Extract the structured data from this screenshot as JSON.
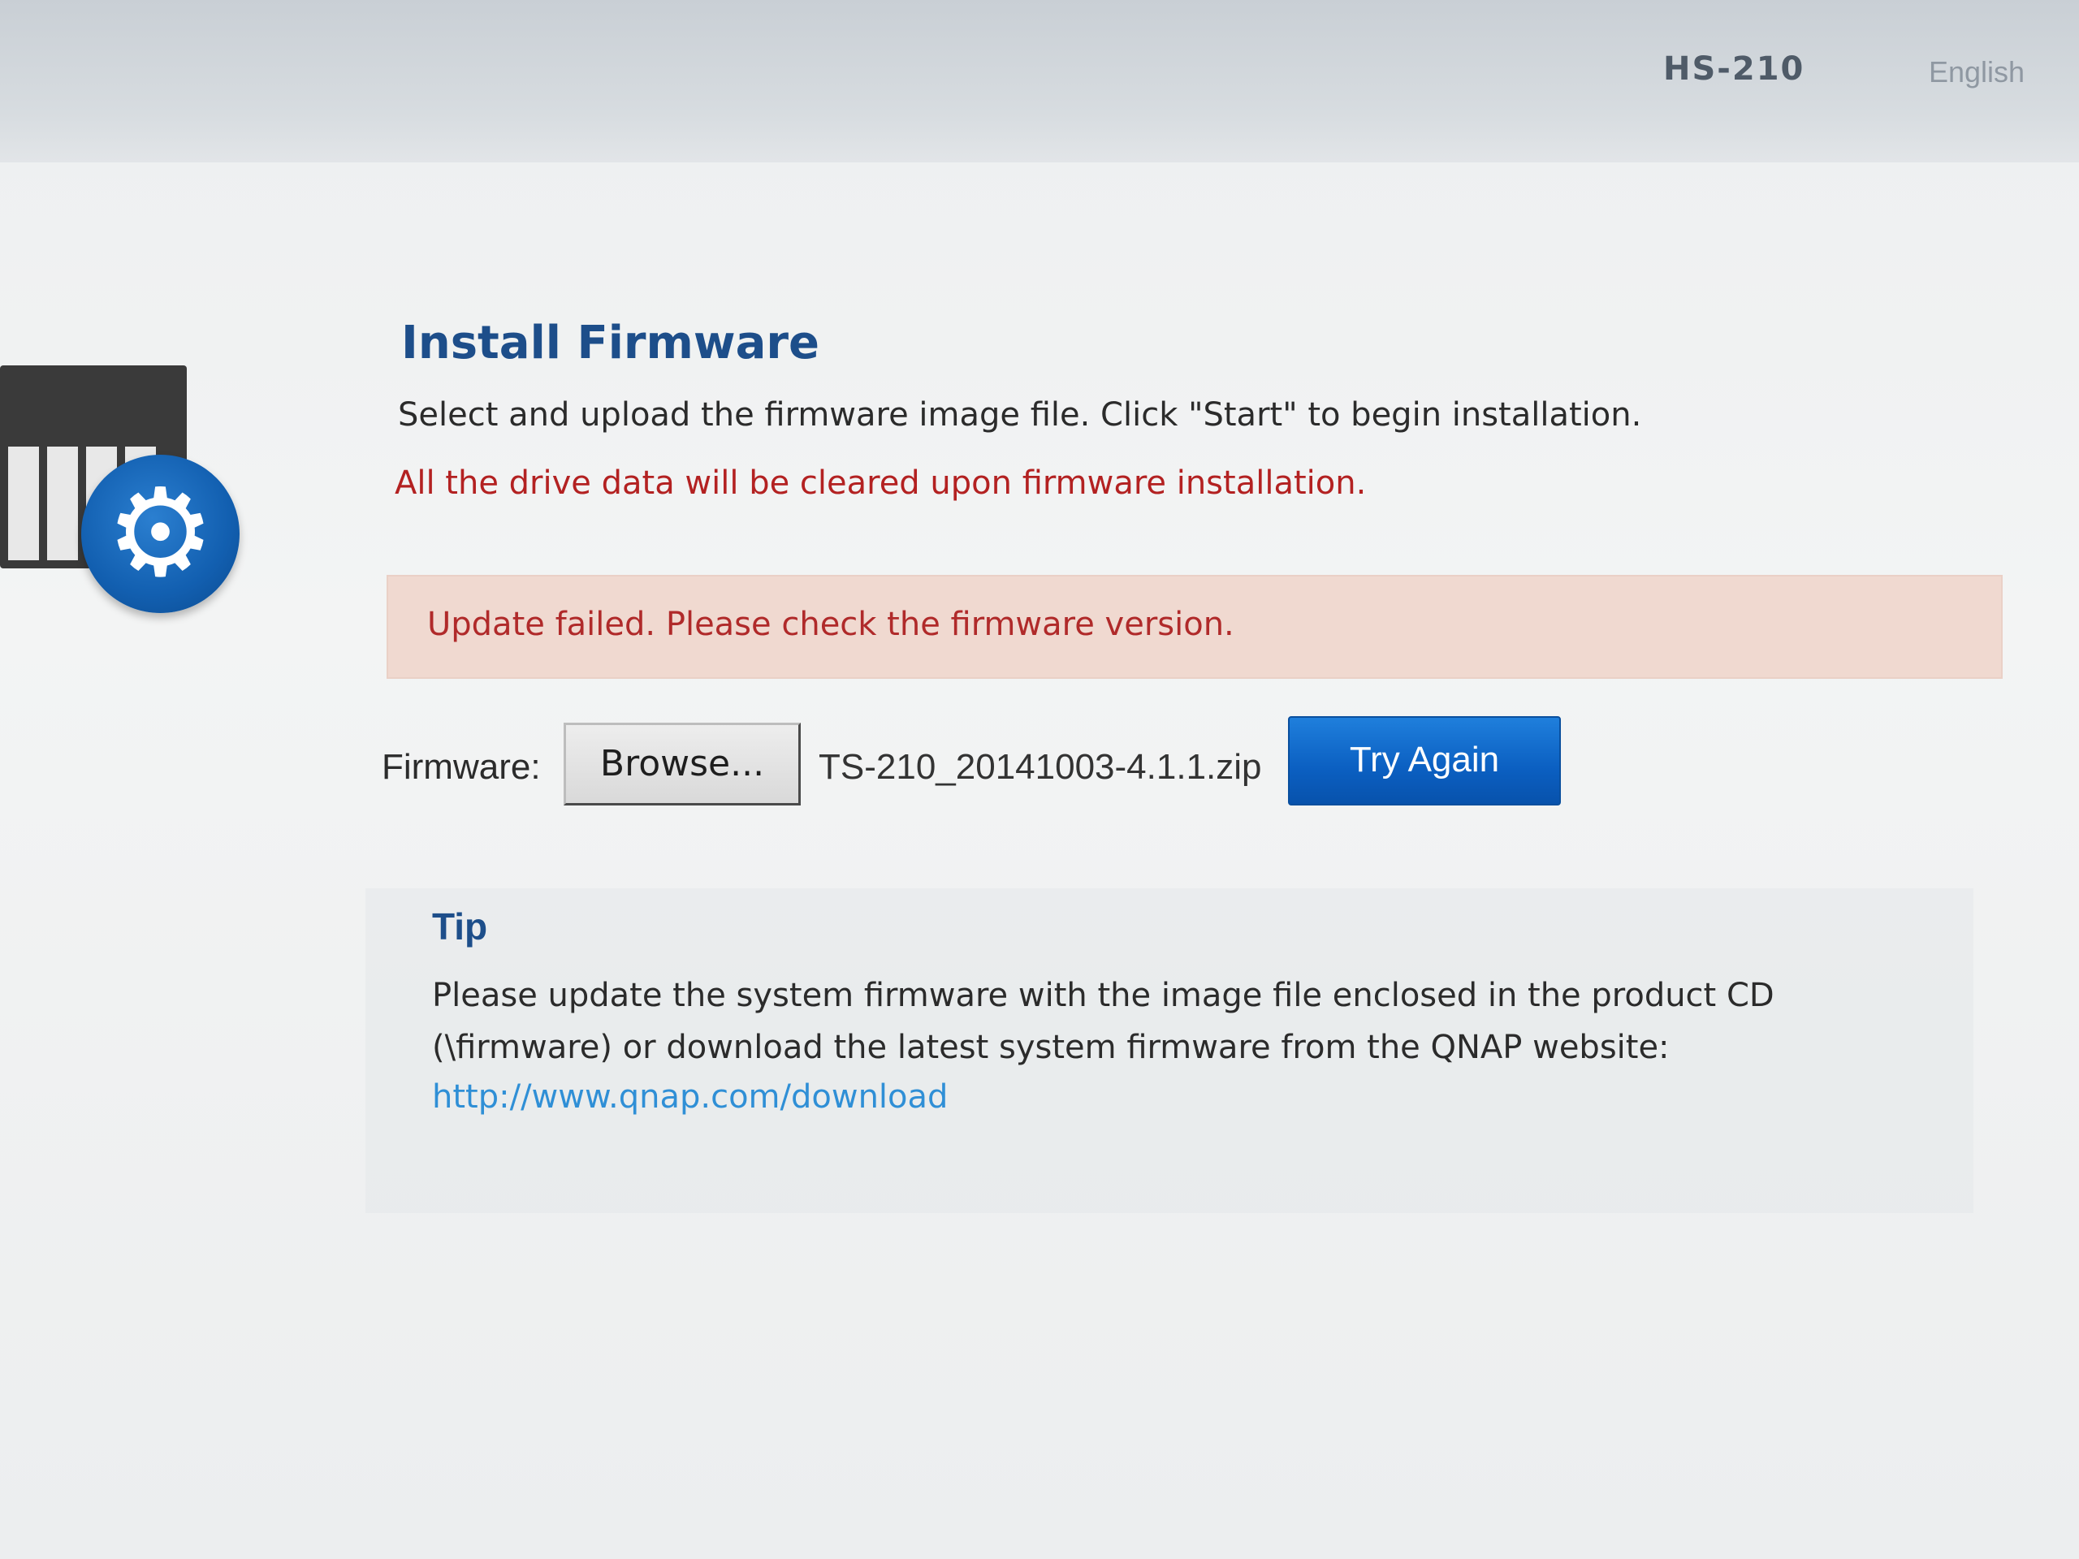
{
  "header": {
    "model_name": "HS-210",
    "right_label": "English"
  },
  "install": {
    "title": "Install Firmware",
    "description": "Select and upload the firmware image file. Click \"Start\" to begin installation.",
    "warning": "All the drive data will be cleared upon firmware installation.",
    "error_message": "Update failed. Please check the firmware version.",
    "firmware_label": "Firmware:",
    "browse_label": "Browse...",
    "selected_file": "TS-210_20141003-4.1.1.zip",
    "try_again_label": "Try Again"
  },
  "tip": {
    "title": "Tip",
    "body": "Please update the system firmware with the image file enclosed in the product CD (\\firmware) or download the latest system firmware from the QNAP website:",
    "link": "http://www.qnap.com/download"
  },
  "icons": {
    "device": "nas-device-icon",
    "gear": "gear-icon"
  },
  "colors": {
    "title": "#1d4e8a",
    "warning": "#b32121",
    "error_bg": "#f0d9d0",
    "primary_button": "#0b5fc1",
    "link": "#2f8fd6"
  }
}
